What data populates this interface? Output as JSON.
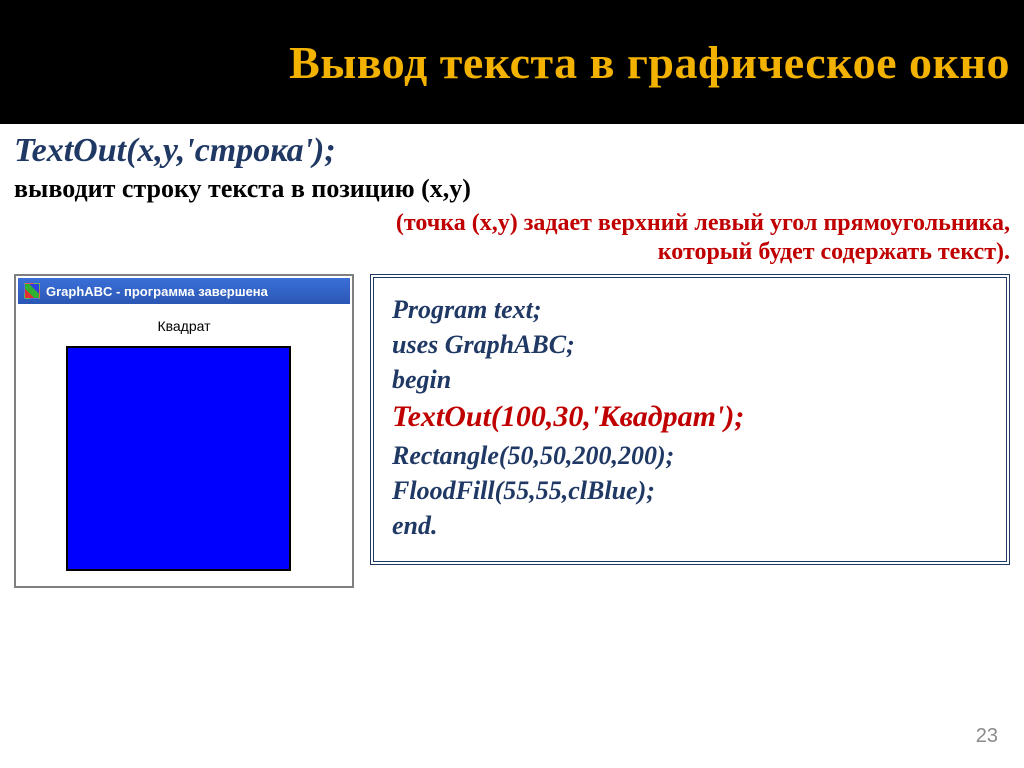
{
  "title": "Вывод текста в графическое окно",
  "syntax": "TextOut(x,y,'строка');",
  "description": "выводит строку текста в позицию (x,y)",
  "hint1": "(точка (x,y) задает верхний левый угол прямоугольника,",
  "hint2": "который будет содержать текст).",
  "window": {
    "title": "GraphABC - программа завершена",
    "label": "Квадрат"
  },
  "code": {
    "l1": "Program text;",
    "l2": "uses GraphABC;",
    "l3": "begin",
    "l4": "TextOut(100,30,'Квадрат');",
    "l5": "Rectangle(50,50,200,200);",
    "l6": "FloodFill(55,55,clBlue);",
    "l7": "end."
  },
  "page": "23"
}
